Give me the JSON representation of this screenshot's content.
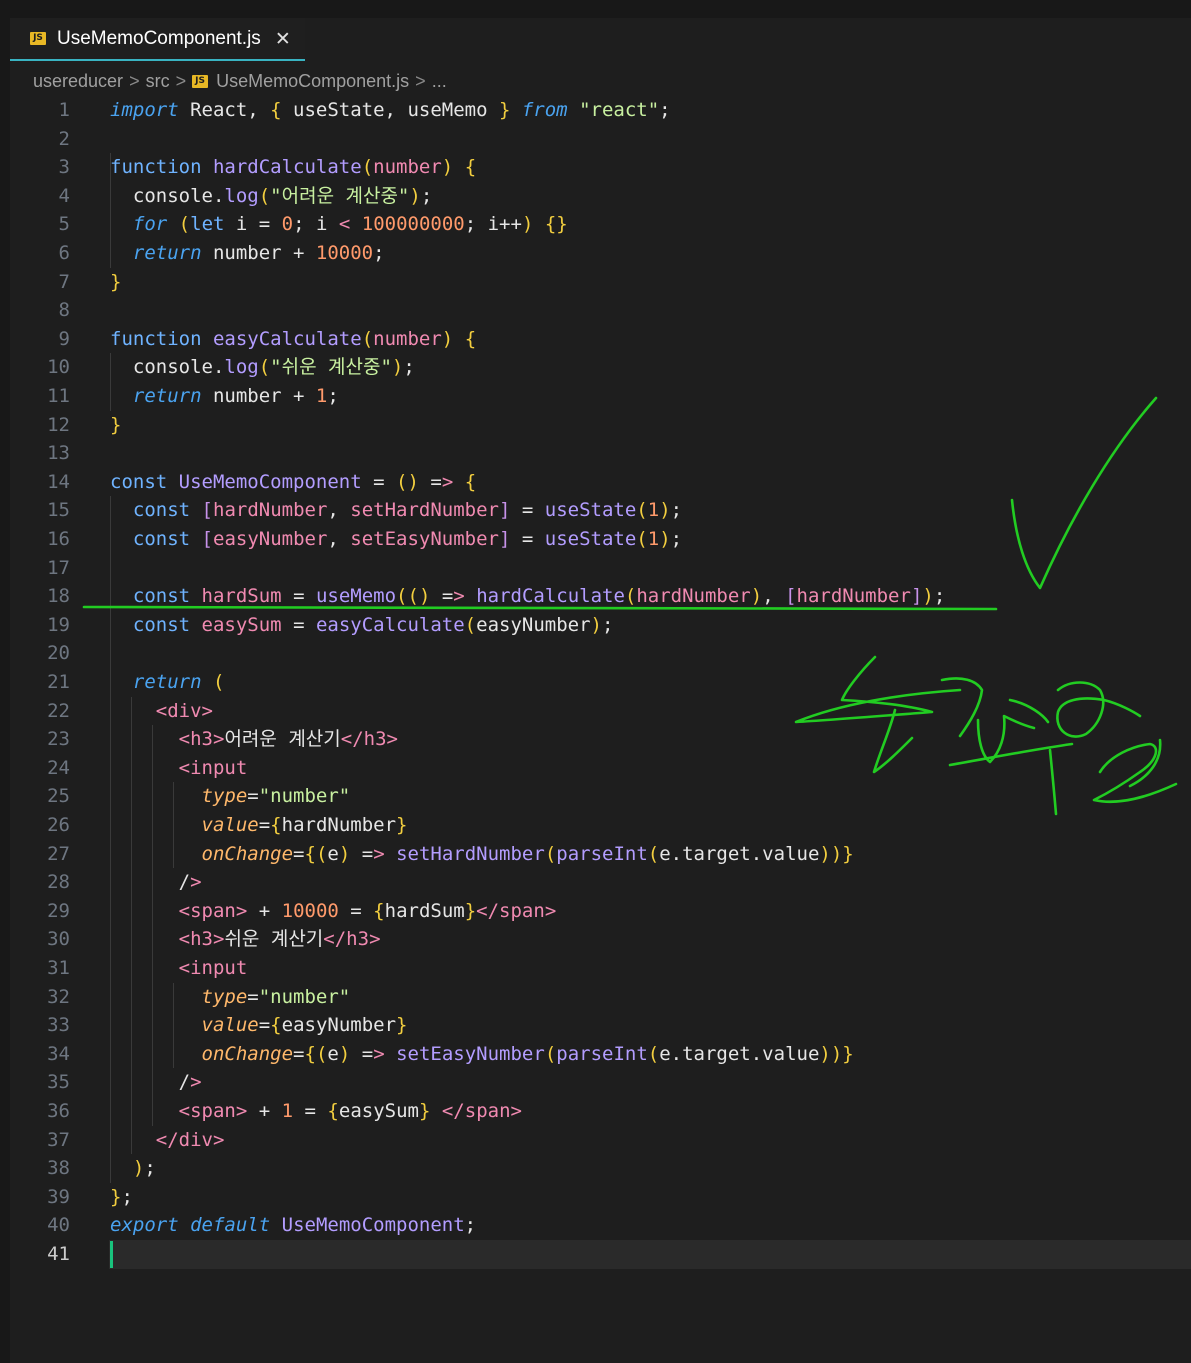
{
  "tab": {
    "title": "UseMemoComponent.js",
    "icon": "JS",
    "close": "✕"
  },
  "breadcrumb": {
    "parts": [
      "usereducer",
      "src",
      "UseMemoComponent.js",
      "..."
    ],
    "separator": ">"
  },
  "editor": {
    "current_line": 41,
    "lines": [
      "import React, { useState, useMemo } from \"react\";",
      "",
      "function hardCalculate(number) {",
      "  console.log(\"어려운 계산중\");",
      "  for (let i = 0; i < 100000000; i++) {}",
      "  return number + 10000;",
      "}",
      "",
      "function easyCalculate(number) {",
      "  console.log(\"쉬운 계산중\");",
      "  return number + 1;",
      "}",
      "",
      "const UseMemoComponent = () => {",
      "  const [hardNumber, setHardNumber] = useState(1);",
      "  const [easyNumber, setEasyNumber] = useState(1);",
      "",
      "  const hardSum = useMemo(() => hardCalculate(hardNumber), [hardNumber]);",
      "  const easySum = easyCalculate(easyNumber);",
      "",
      "  return (",
      "    <div>",
      "      <h3>어려운 계산기</h3>",
      "      <input",
      "        type=\"number\"",
      "        value={hardNumber}",
      "        onChange={(e) => setHardNumber(parseInt(e.target.value))}",
      "      />",
      "      <span> + 10000 = {hardSum}</span>",
      "      <h3>쉬운 계산기</h3>",
      "      <input",
      "        type=\"number\"",
      "        value={easyNumber}",
      "        onChange={(e) => setEasyNumber(parseInt(e.target.value))}",
      "      />",
      "      <span> + 1 = {easySum} </span>",
      "    </div>",
      "  );",
      "};",
      "export default UseMemoComponent;",
      ""
    ]
  },
  "colors": {
    "background": "#1e1e1e",
    "annotation": "#22cc22",
    "tab_underline": "#39b3c2",
    "cursor": "#19c37d"
  }
}
